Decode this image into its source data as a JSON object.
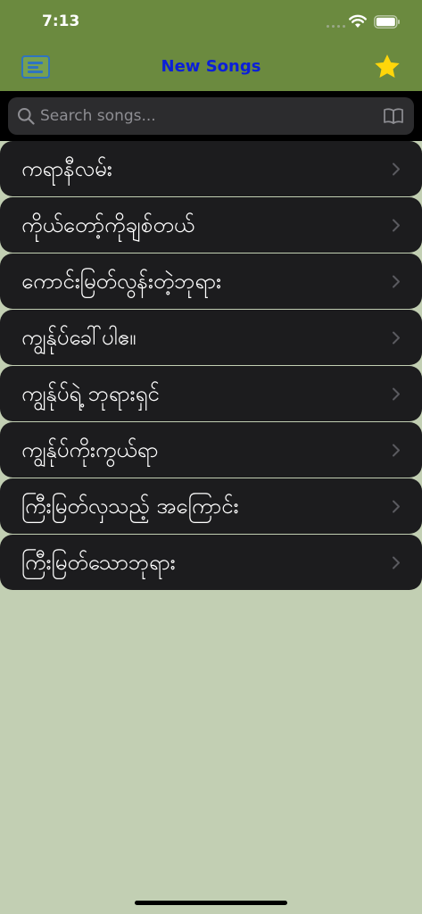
{
  "status_bar": {
    "time": "7:13"
  },
  "nav": {
    "title": "New Songs"
  },
  "search": {
    "placeholder": "Search songs..."
  },
  "songs": [
    {
      "title": "ကရာနီလမ်း"
    },
    {
      "title": "ကိုယ်တော့်ကိုချစ်တယ်"
    },
    {
      "title": "ကောင်းမြတ်လွန်းတဲ့ဘုရား"
    },
    {
      "title": "ကျွန်ုပ်ခေါ်ပါဧ။"
    },
    {
      "title": "ကျွန်ုပ်ရဲ့ ဘုရားရှင်"
    },
    {
      "title": "ကျွန်ုပ်ကိုးကွယ်ရာ"
    },
    {
      "title": "ကြီးမြတ်လှသည့် အကြောင်း"
    },
    {
      "title": "ကြီးမြတ်သောဘုရား"
    }
  ],
  "colors": {
    "nav_background": "#6b8a3f",
    "title_text": "#0b1fd9",
    "menu_icon": "#2f74c0",
    "star": "#ffd60a",
    "row_background": "#1c1c1e",
    "page_background": "#c2cfb3"
  }
}
